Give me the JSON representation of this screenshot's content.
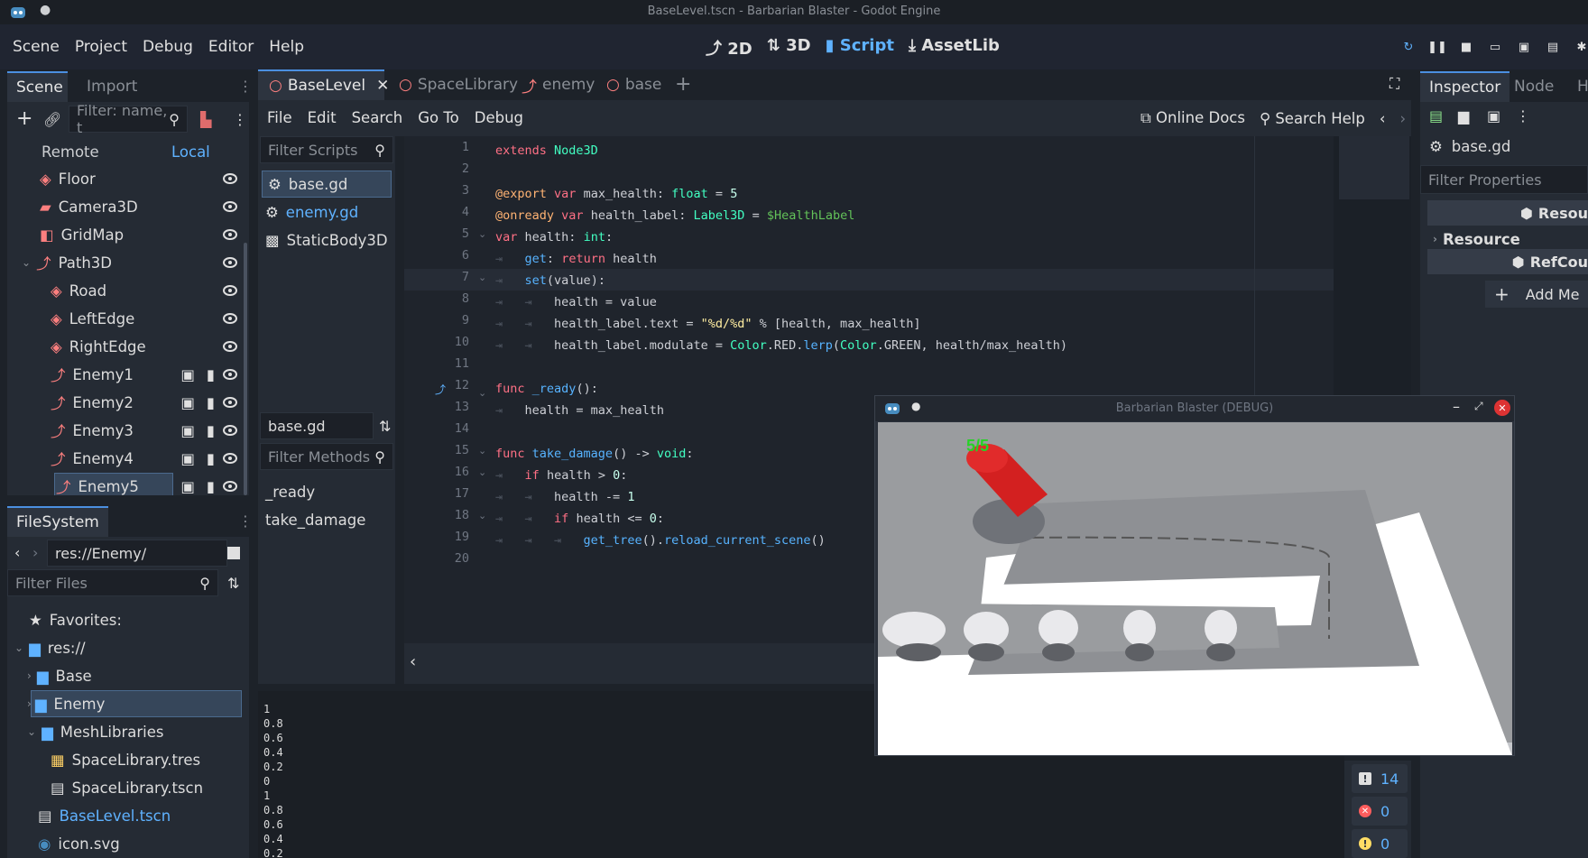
{
  "window": {
    "title": "BaseLevel.tscn - Barbarian Blaster - Godot Engine"
  },
  "menu": [
    "Scene",
    "Project",
    "Debug",
    "Editor",
    "Help"
  ],
  "modes": [
    {
      "icon": "2d-icon",
      "label": "2D"
    },
    {
      "icon": "3d-icon",
      "label": "3D"
    },
    {
      "icon": "script-icon",
      "label": "Script",
      "active": true
    },
    {
      "icon": "assetlib-icon",
      "label": "AssetLib"
    }
  ],
  "scene_dock": {
    "tabs": [
      "Scene",
      "Import"
    ],
    "filter_placeholder": "Filter: name, t",
    "remote": "Remote",
    "local": "Local",
    "nodes": [
      "Floor",
      "Camera3D",
      "GridMap",
      "Path3D",
      "Road",
      "LeftEdge",
      "RightEdge",
      "Enemy1",
      "Enemy2",
      "Enemy3",
      "Enemy4",
      "Enemy5"
    ]
  },
  "filesystem": {
    "tab": "FileSystem",
    "path": "res://Enemy/",
    "filter_placeholder": "Filter Files",
    "items": [
      "Favorites:",
      "res://",
      "Base",
      "Enemy",
      "MeshLibraries",
      "SpaceLibrary.tres",
      "SpaceLibrary.tscn",
      "BaseLevel.tscn",
      "icon.svg"
    ]
  },
  "editor_tabs": [
    "BaseLevel",
    "SpaceLibrary",
    "enemy",
    "base"
  ],
  "script_menu": [
    "File",
    "Edit",
    "Search",
    "Go To",
    "Debug"
  ],
  "online_docs": "Online Docs",
  "search_help": "Search Help",
  "scripts": {
    "filter_placeholder": "Filter Scripts",
    "list": [
      "base.gd",
      "enemy.gd",
      "StaticBody3D"
    ],
    "current": "base.gd",
    "methods_placeholder": "Filter Methods",
    "methods": [
      "_ready",
      "take_damage"
    ]
  },
  "code_lines": [
    "1",
    "2",
    "3",
    "4",
    "5",
    "6",
    "7",
    "8",
    "9",
    "10",
    "11",
    "12",
    "13",
    "14",
    "15",
    "16",
    "17",
    "18",
    "19",
    "20"
  ],
  "output_lines": [
    "1",
    "0.8",
    "0.6",
    "0.4",
    "0.2",
    "0",
    "1",
    "0.8",
    "0.6",
    "0.4",
    "0.2"
  ],
  "counters": {
    "messages": "14",
    "errors": "0",
    "warnings": "0"
  },
  "inspector": {
    "tabs": [
      "Inspector",
      "Node",
      "Hi"
    ],
    "object": "base.gd",
    "filter_placeholder": "Filter Properties",
    "resource_header": "Resou",
    "resource_section": "Resource",
    "refcounted_header": "RefCou",
    "add_metadata": "Add Me"
  },
  "debug_window": {
    "title": "Barbarian Blaster (DEBUG)",
    "health_label": "5/5"
  },
  "colors": {
    "accent": "#5fb2ff",
    "background": "#1d2229",
    "panel": "#252b34"
  }
}
